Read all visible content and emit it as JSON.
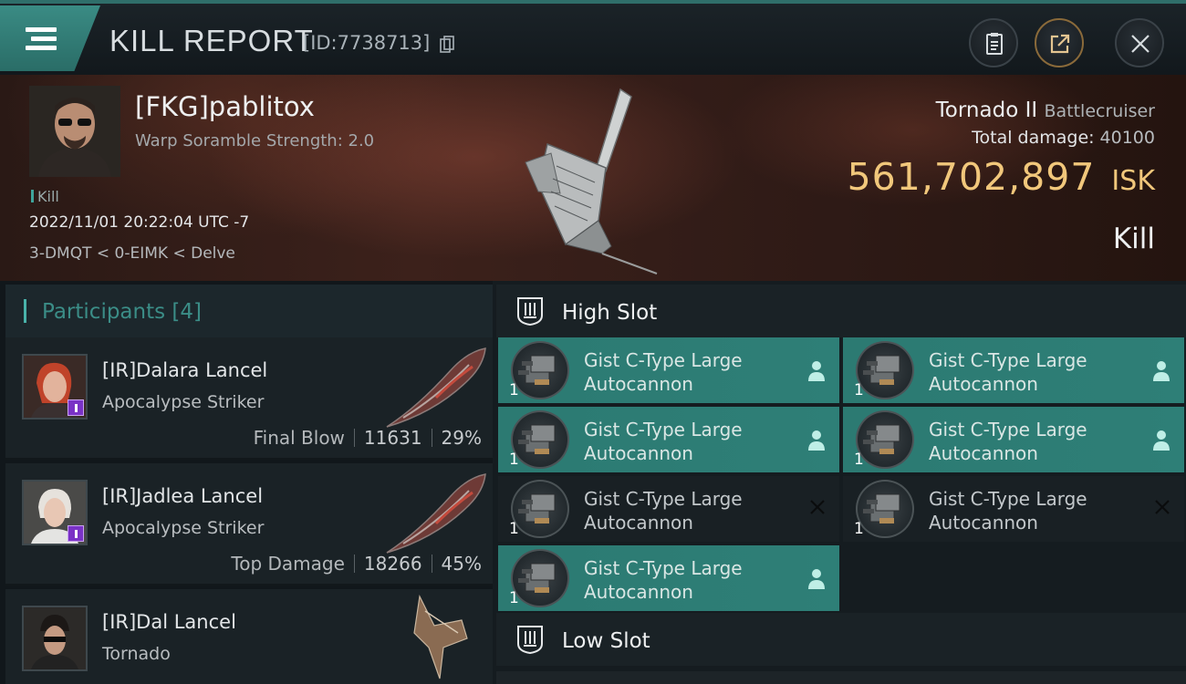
{
  "header": {
    "title": "KILL REPORT",
    "report_id": "[ID:7738713]",
    "icons": [
      "menu-icon",
      "copy-icon",
      "notes-icon",
      "share-icon",
      "close-icon"
    ]
  },
  "victim": {
    "name": "[FKG]pablitox",
    "subtitle": "Warp Soramble Strength: 2.0",
    "tag": "Kill",
    "time": "2022/11/01 20:22:04 UTC -7",
    "location": "3-DMQT < 0-EIMK < Delve",
    "ship": "Tornado II",
    "ship_class": "Battlecruiser",
    "damage_label": "Total damage:",
    "damage_value": "40100",
    "isk_value": "561,702,897",
    "isk_unit": "ISK",
    "result": "Kill"
  },
  "participants": {
    "title": "Participants [4]",
    "items": [
      {
        "name": "[IR]Dalara Lancel",
        "ship": "Apocalypse Striker",
        "label": "Final Blow",
        "damage": "11631",
        "percent": "29%"
      },
      {
        "name": "[IR]Jadlea Lancel",
        "ship": "Apocalypse Striker",
        "label": "Top Damage",
        "damage": "18266",
        "percent": "45%"
      },
      {
        "name": "[IR]Dal Lancel",
        "ship": "Tornado"
      }
    ]
  },
  "fitting": {
    "high_slot": {
      "title": "High Slot",
      "modules": [
        {
          "line1": "Gist C-Type Large",
          "line2": "Autocannon",
          "qty": "1",
          "state": "on"
        },
        {
          "line1": "Gist C-Type Large",
          "line2": "Autocannon",
          "qty": "1",
          "state": "on"
        },
        {
          "line1": "Gist C-Type Large",
          "line2": "Autocannon",
          "qty": "1",
          "state": "on"
        },
        {
          "line1": "Gist C-Type Large",
          "line2": "Autocannon",
          "qty": "1",
          "state": "on"
        },
        {
          "line1": "Gist C-Type Large",
          "line2": "Autocannon",
          "qty": "1",
          "state": "off"
        },
        {
          "line1": "Gist C-Type Large",
          "line2": "Autocannon",
          "qty": "1",
          "state": "off"
        },
        {
          "line1": "Gist C-Type Large",
          "line2": "Autocannon",
          "qty": "1",
          "state": "on"
        }
      ]
    },
    "low_slot": {
      "title": "Low Slot"
    }
  },
  "colors": {
    "accent": "#2e7f77",
    "isk": "#f1c77b",
    "badge": "#7a32c6"
  }
}
